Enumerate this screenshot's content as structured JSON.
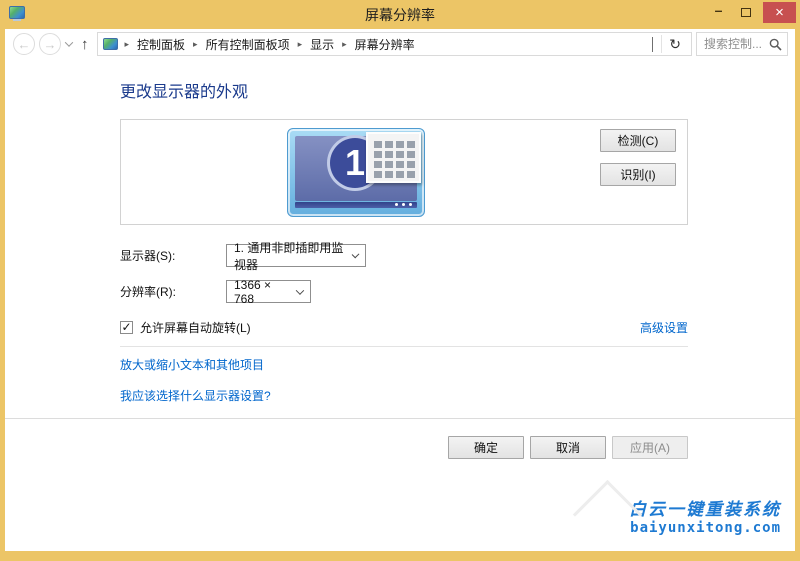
{
  "titlebar": {
    "title": "屏幕分辨率"
  },
  "icons": {
    "minimize": "–",
    "close": "×",
    "back": "←",
    "forward": "→",
    "up": "↑",
    "refresh": "↻",
    "breadcrumb_separator": "▸",
    "check": "✓"
  },
  "address_bar": {
    "breadcrumbs": [
      "控制面板",
      "所有控制面板项",
      "显示",
      "屏幕分辨率"
    ],
    "search_placeholder": "搜索控制..."
  },
  "content": {
    "heading": "更改显示器的外观",
    "monitor_label": "1",
    "detect_button": "检测(C)",
    "identify_button": "识别(I)",
    "display_label": "显示器(S):",
    "display_value": "1. 通用非即插即用监视器",
    "resolution_label": "分辨率(R):",
    "resolution_value": "1366 × 768",
    "rotation_checkbox": "允许屏幕自动旋转(L)",
    "advanced_settings_link": "高级设置",
    "resize_text_link": "放大或缩小文本和其他项目",
    "help_link": "我应该选择什么显示器设置?",
    "ok_button": "确定",
    "cancel_button": "取消",
    "apply_button": "应用(A)"
  },
  "watermark": {
    "title": "白云一键重装系统",
    "url": "baiyunxitong.com"
  },
  "colors": {
    "titlebar_bg": "#ecc566",
    "close_button": "#c75050",
    "heading": "#1a3a8c",
    "link": "#0066cc",
    "monitor_screen": "#6674ae",
    "monitor_circle": "#3c4c9a",
    "monitor_frame": "#8fd0f0",
    "watermark_text": "#1e7ad2"
  }
}
